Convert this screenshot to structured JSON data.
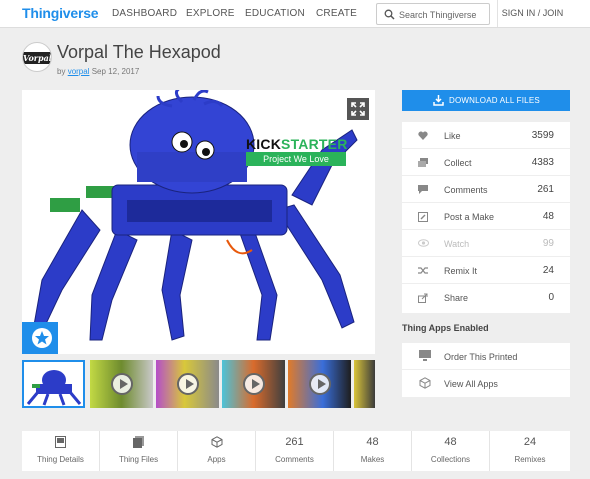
{
  "nav": {
    "logo": "Thingiverse",
    "items": [
      "DASHBOARD",
      "EXPLORE",
      "EDUCATION",
      "CREATE"
    ],
    "search_placeholder": "Search Thingiverse",
    "signin": "SIGN IN / JOIN"
  },
  "thing": {
    "title": "Vorpal The Hexapod",
    "by_prefix": "by",
    "author": "vorpal",
    "date": "Sep 12, 2017",
    "avatar_text": "Vorpal"
  },
  "main_image": {
    "kickstarter_a": "KICK",
    "kickstarter_b": "STARTER",
    "badge": "Project We Love"
  },
  "thumbnails": [
    {
      "kind": "image",
      "active": true
    },
    {
      "kind": "video"
    },
    {
      "kind": "video"
    },
    {
      "kind": "video"
    },
    {
      "kind": "video"
    },
    {
      "kind": "video"
    }
  ],
  "download_label": "DOWNLOAD ALL FILES",
  "stats": [
    {
      "label": "Like",
      "value": "3599",
      "icon": "heart-icon"
    },
    {
      "label": "Collect",
      "value": "4383",
      "icon": "collect-icon"
    },
    {
      "label": "Comments",
      "value": "261",
      "icon": "comment-icon"
    },
    {
      "label": "Post a Make",
      "value": "48",
      "icon": "make-icon"
    },
    {
      "label": "Watch",
      "value": "99",
      "icon": "eye-icon",
      "disabled": true
    },
    {
      "label": "Remix It",
      "value": "24",
      "icon": "remix-icon"
    },
    {
      "label": "Share",
      "value": "0",
      "icon": "share-icon"
    }
  ],
  "apps": {
    "heading": "Thing Apps Enabled",
    "items": [
      {
        "label": "Order This Printed",
        "icon": "monitor-icon"
      },
      {
        "label": "View All Apps",
        "icon": "cube-icon"
      }
    ]
  },
  "tabs": [
    {
      "top": "",
      "label": "Thing Details",
      "icon": "details-icon"
    },
    {
      "top": "",
      "label": "Thing Files",
      "icon": "files-icon"
    },
    {
      "top": "",
      "label": "Apps",
      "icon": "cube-icon"
    },
    {
      "top": "261",
      "label": "Comments"
    },
    {
      "top": "48",
      "label": "Makes"
    },
    {
      "top": "48",
      "label": "Collections"
    },
    {
      "top": "24",
      "label": "Remixes"
    }
  ],
  "colors": {
    "accent": "#1f8eea",
    "kickstarter_green": "#2bb35a",
    "robot_blue": "#2c3cc8"
  }
}
